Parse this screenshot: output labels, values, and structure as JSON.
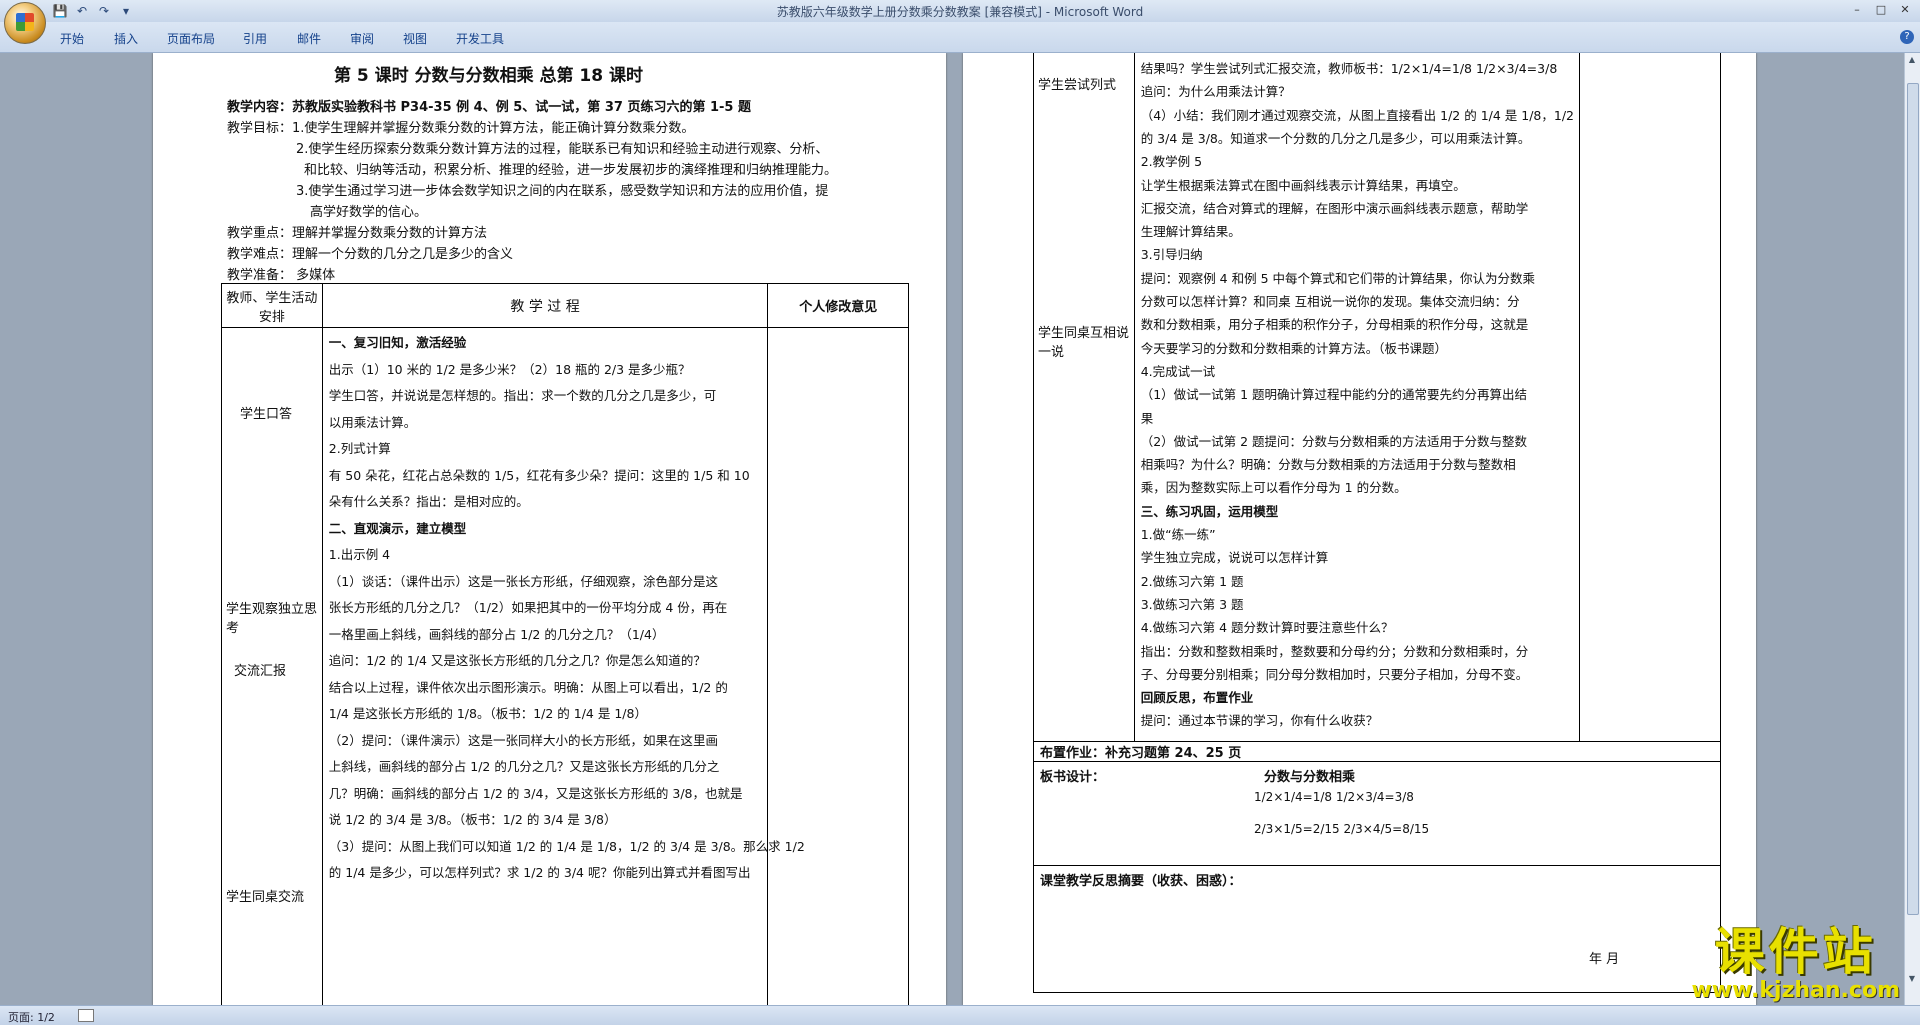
{
  "window": {
    "title": "苏教版六年级数学上册分数乘分数教案 [兼容模式] - Microsoft Word"
  },
  "ribbon": {
    "tabs": [
      "开始",
      "插入",
      "页面布局",
      "引用",
      "邮件",
      "审阅",
      "视图",
      "开发工具"
    ]
  },
  "status": {
    "page": "页面: 1/2"
  },
  "watermark": {
    "big": "课件站",
    "small": "www.kjzhan.com"
  },
  "page1": {
    "header": "第 5 课时      分数与分数相乘      总第   18  课时",
    "lines": [
      "教学内容：苏教版实验教科书 P34-35 例 4、例 5、试一试，第 37 页练习六的第 1-5 题",
      "教学目标：1.使学生理解并掌握分数乘分数的计算方法，能正确计算分数乘分数。",
      "2.使学生经历探索分数乘分数计算方法的过程，能联系已有知识和经验主动进行观察、分析、",
      "和比较、归纳等活动，积累分析、推理的经验，进一步发展初步的演绎推理和归纳推理能力。",
      "3.使学生通过学习进一步体会数学知识之间的内在联系，感受数学知识和方法的应用价值，提",
      "高学好数学的信心。",
      "教学重点：理解并掌握分数乘分数的计算方法",
      "教学难点：理解一个分数的几分之几是多少的含义",
      "教学准备：  多媒体"
    ],
    "table_head": [
      "教师、学生活动安排",
      "教 学 过 程",
      "个人修改意见"
    ],
    "left_col": [
      "学生口答",
      "学生观察独立思考",
      "交流汇报",
      "学生同桌交流"
    ],
    "body": [
      "一、复习旧知，激活经验",
      "出示（1）10 米的 1/2 是多少米？（2）18 瓶的 2/3 是多少瓶？",
      "学生口答，并说说是怎样想的。指出：求一个数的几分之几是多少，可",
      "以用乘法计算。",
      "2.列式计算",
      "有 50 朵花，红花占总朵数的 1/5，红花有多少朵？提问：这里的 1/5 和 10",
      "朵有什么关系？指出：是相对应的。",
      "二、直观演示，建立模型",
      "1.出示例 4",
      "（1）谈话：（课件出示）这是一张长方形纸，仔细观察，涂色部分是这",
      "张长方形纸的几分之几？（1/2）如果把其中的一份平均分成 4 份，再在",
      "一格里画上斜线，画斜线的部分占 1/2 的几分之几？（1/4）",
      "追问：1/2 的 1/4 又是这张长方形纸的几分之几？你是怎么知道的？",
      "结合以上过程，课件依次出示图形演示。明确：从图上可以看出，1/2 的",
      "1/4 是这张长方形纸的 1/8。（板书：1/2 的 1/4 是 1/8）",
      "（2）提问：（课件演示）这是一张同样大小的长方形纸，如果在这里画",
      "上斜线，画斜线的部分占 1/2 的几分之几？又是这张长方形纸的几分之",
      "几？明确：画斜线的部分占 1/2 的 3/4，又是这张长方形纸的 3/8，也就是",
      "说 1/2 的 3/4 是 3/8。（板书：1/2 的 3/4 是 3/8）",
      "（3）提问：从图上我们可以知道 1/2 的 1/4 是 1/8，1/2 的 3/4 是 3/8。那么求 1/2",
      "的 1/4 是多少，可以怎样列式？求 1/2 的 3/4 呢？你能列出算式并看图写出"
    ]
  },
  "page2": {
    "left_col": [
      "学生尝试列式",
      "学生同桌互相说一说"
    ],
    "body": [
      "结果吗？学生尝试列式汇报交流，教师板书：1/2×1/4=1/8  1/2×3/4=3/8",
      "追问：为什么用乘法计算？",
      "（4）小结：我们刚才通过观察交流，从图上直接看出 1/2 的 1/4 是 1/8，1/2",
      "的 3/4 是 3/8。知道求一个分数的几分之几是多少，可以用乘法计算。",
      "2.教学例 5",
      "让学生根据乘法算式在图中画斜线表示计算结果，再填空。",
      "汇报交流，结合对算式的理解，在图形中演示画斜线表示题意，帮助学",
      "生理解计算结果。",
      "3.引导归纳",
      "提问：观察例 4 和例 5 中每个算式和它们带的计算结果，你认为分数乘",
      "分数可以怎样计算？和同桌 互相说一说你的发现。集体交流归纳：分",
      "数和分数相乘，用分子相乘的积作分子，分母相乘的积作分母，这就是",
      "今天要学习的分数和分数相乘的计算方法。（板书课题）",
      "4.完成试一试",
      "（1）做试一试第 1 题明确计算过程中能约分的通常要先约分再算出结",
      "果",
      "（2）做试一试第 2 题提问：分数与分数相乘的方法适用于分数与整数",
      "相乘吗？为什么？明确：分数与分数相乘的方法适用于分数与整数相",
      "乘，因为整数实际上可以看作分母为 1 的分数。",
      "三、练习巩固，运用模型",
      "1.做“练一练”",
      "学生独立完成，说说可以怎样计算",
      "2.做练习六第 1 题",
      "3.做练习六第 3 题",
      "4.做练习六第 4 题分数计算时要注意些什么？",
      "指出：分数和整数相乘时，整数要和分母约分；分数和分数相乘时，分",
      "子、分母要分别相乘；同分母分数相加时，只要分子相加，分母不变。",
      "回顾反思，布置作业",
      "提问：通过本节课的学习，你有什么收获？"
    ],
    "homework": "布置作业：补充习题第 24、25 页",
    "board_label": "板书设计：",
    "board_title": "分数与分数相乘",
    "board_eq1": "1/2×1/4=1/8  1/2×3/4=3/8",
    "board_eq2": "2/3×1/5=2/15  2/3×4/5=8/15",
    "reflection": "课堂教学反思摘要（收获、困惑）：",
    "date": "年      月"
  },
  "colors": {
    "ribbon": "#c9d8ec",
    "workspace": "#9aa7b7",
    "watermark": "#e8e000"
  }
}
